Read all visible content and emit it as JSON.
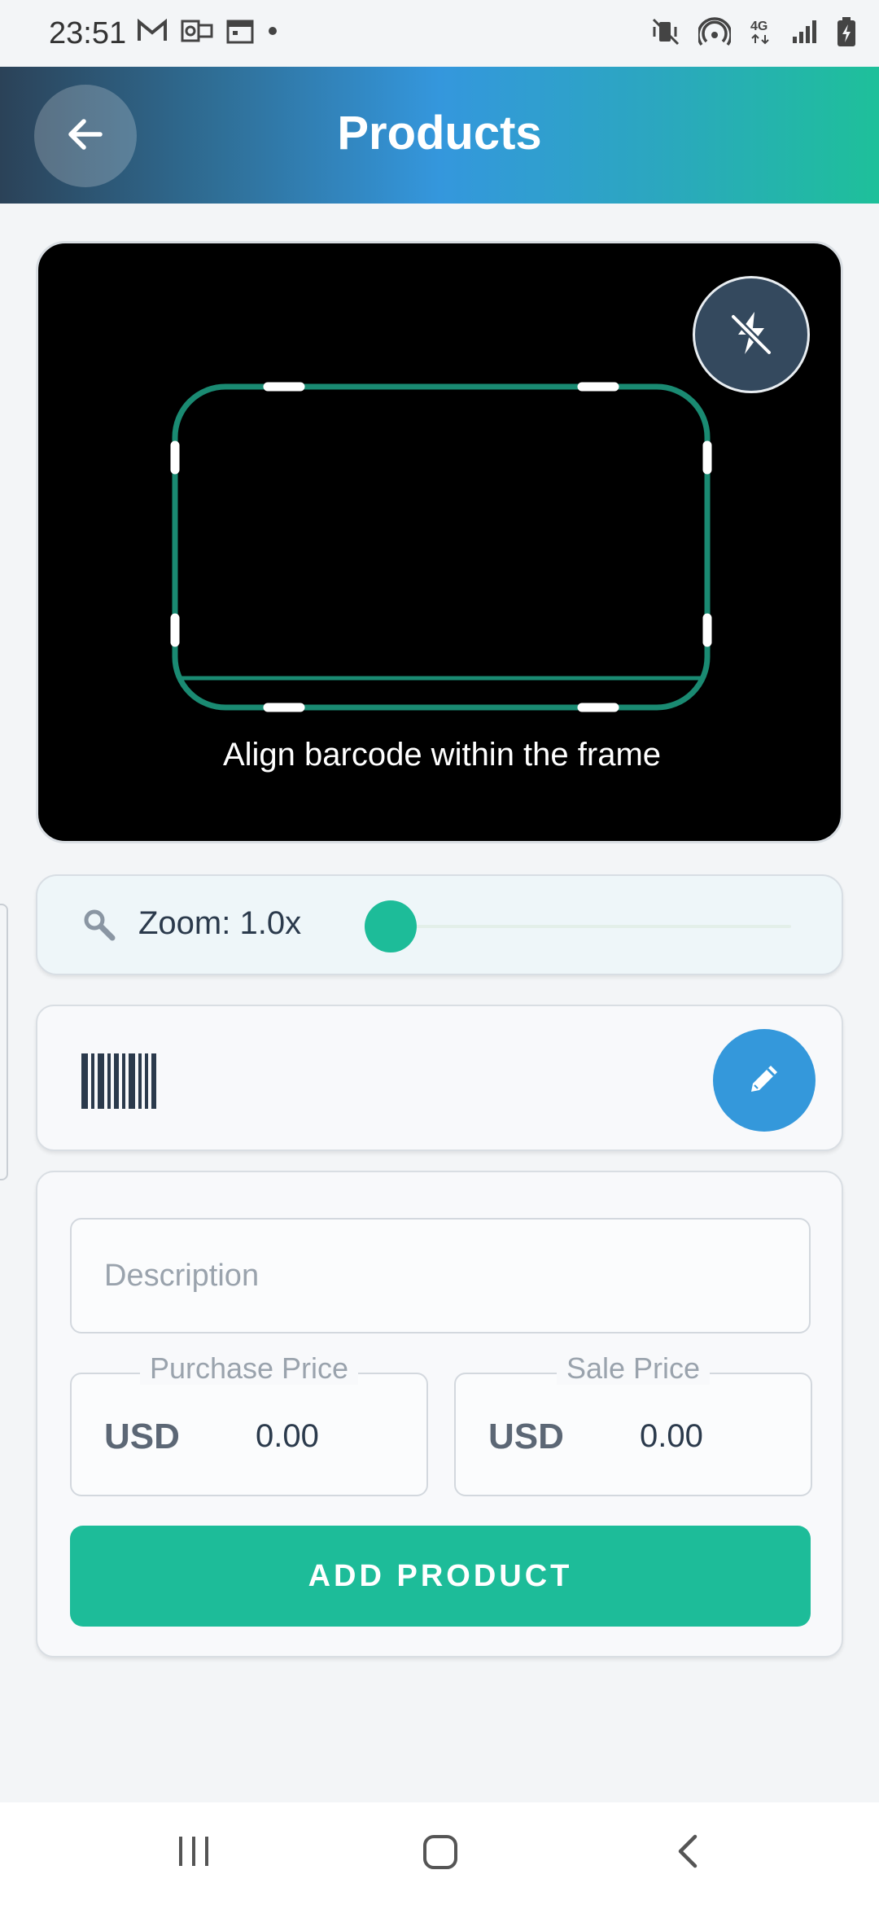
{
  "status_bar": {
    "time": "23:51",
    "left_icons": [
      "gmail-icon",
      "outlook-icon",
      "calendar-icon",
      "dot-icon"
    ],
    "right_icons": [
      "mute-vibrate-icon",
      "hotspot-icon",
      "network-4g-icon",
      "signal-icon",
      "battery-charging-icon"
    ],
    "network_label": "4G"
  },
  "app_bar": {
    "title": "Products",
    "back_icon": "arrow-left-icon"
  },
  "scanner": {
    "hint": "Align barcode within the frame",
    "flash_icon": "flash-off-icon",
    "frame_color": "#1a8a72"
  },
  "zoom": {
    "label": "Zoom: 1.0x",
    "value": 1.0,
    "icon": "magnifier-icon"
  },
  "barcode": {
    "icon": "barcode-icon",
    "edit_icon": "pencil-icon"
  },
  "form": {
    "description_placeholder": "Description",
    "purchase_price": {
      "label": "Purchase Price",
      "currency": "USD",
      "value": "0.00"
    },
    "sale_price": {
      "label": "Sale Price",
      "currency": "USD",
      "value": "0.00"
    },
    "add_button_label": "ADD PRODUCT"
  },
  "colors": {
    "accent": "#1dbc99",
    "blue": "#3498db",
    "dark": "#34495e"
  },
  "nav_bar": {
    "buttons": [
      "recents-icon",
      "home-icon",
      "back-nav-icon"
    ]
  }
}
